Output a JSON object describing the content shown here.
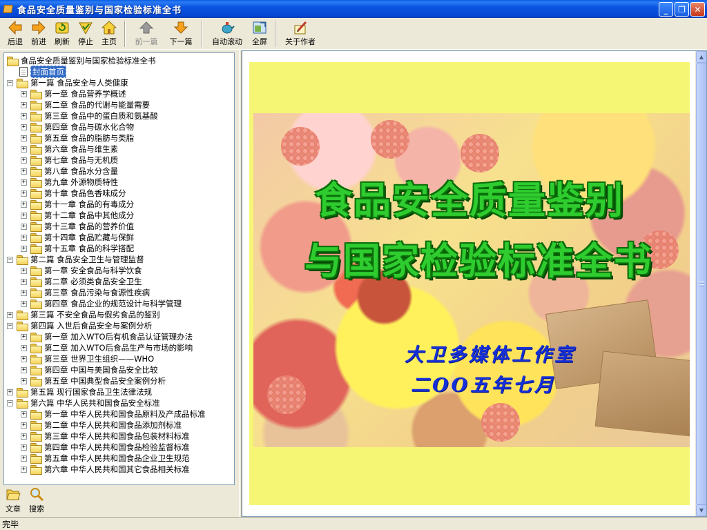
{
  "window": {
    "title": "食品安全质量鉴别与国家检验标准全书",
    "controls": {
      "minimize": "_",
      "maximize": "❐",
      "close": "✕"
    }
  },
  "toolbar": {
    "back": "后退",
    "forward": "前进",
    "refresh": "刷新",
    "stop": "停止",
    "home": "主页",
    "prev_article": "前一篇",
    "next_article": "下一篇",
    "auto_scroll": "自动滚动",
    "fullscreen": "全屏",
    "about": "关于作者"
  },
  "tree": {
    "root": "食品安全质量鉴别与国家检验标准全书",
    "cover": "封面首页",
    "nodes": [
      {
        "label": "第一篇  食品安全与人类健康",
        "level": 1,
        "expanded": true
      },
      {
        "label": "第一章  食品营养学概述",
        "level": 2
      },
      {
        "label": "第二章  食品的代谢与能量需要",
        "level": 2
      },
      {
        "label": "第三章  食品中的蛋白质和氨基酸",
        "level": 2
      },
      {
        "label": "第四章  食品与碳水化合物",
        "level": 2
      },
      {
        "label": "第五章  食品的脂肪与类脂",
        "level": 2
      },
      {
        "label": "第六章  食品与维生素",
        "level": 2
      },
      {
        "label": "第七章  食品与无机质",
        "level": 2
      },
      {
        "label": "第八章  食品水分含量",
        "level": 2
      },
      {
        "label": "第九章  外源物质特性",
        "level": 2
      },
      {
        "label": "第十章  食品色香味成分",
        "level": 2
      },
      {
        "label": "第十一章  食品的有毒成分",
        "level": 2
      },
      {
        "label": "第十二章  食品中其他成分",
        "level": 2
      },
      {
        "label": "第十三章  食品的营养价值",
        "level": 2
      },
      {
        "label": "第十四章  食品贮藏与保鲜",
        "level": 2
      },
      {
        "label": "第十五章  食品的科学搭配",
        "level": 2
      },
      {
        "label": "第二篇  食品安全卫生与管理监督",
        "level": 1,
        "expanded": true
      },
      {
        "label": "第一章  安全食品与科学饮食",
        "level": 2
      },
      {
        "label": "第二章  必须类食品安全卫生",
        "level": 2
      },
      {
        "label": "第三章  食品污染与食源性疾病",
        "level": 2
      },
      {
        "label": "第四章  食品企业的规范设计与科学管理",
        "level": 2
      },
      {
        "label": "第三篇  不安全食品与假劣食品的鉴别",
        "level": 1,
        "expanded": false
      },
      {
        "label": "第四篇  入世后食品安全与案例分析",
        "level": 1,
        "expanded": true
      },
      {
        "label": "第一章  加入WTO后有机食品认证管理办法",
        "level": 2
      },
      {
        "label": "第二章  加入WTO后食品生产与市场的影响",
        "level": 2
      },
      {
        "label": "第三章  世界卫生组织——WHO",
        "level": 2
      },
      {
        "label": "第四章  中国与美国食品安全比较",
        "level": 2
      },
      {
        "label": "第五章  中国典型食品安全案例分析",
        "level": 2
      },
      {
        "label": "第五篇  现行国家食品卫生法律法规",
        "level": 1,
        "expanded": false
      },
      {
        "label": "第六篇  中华人民共和国食品安全标准",
        "level": 1,
        "expanded": true
      },
      {
        "label": "第一章  中华人民共和国食品原料及产成品标准",
        "level": 2
      },
      {
        "label": "第二章  中华人民共和国食品添加剂标准",
        "level": 2
      },
      {
        "label": "第三章  中华人民共和国食品包装材料标准",
        "level": 2
      },
      {
        "label": "第四章  中华人民共和国食品检验监督标准",
        "level": 2
      },
      {
        "label": "第五章  中华人民共和国食品企业卫生规范",
        "level": 2
      },
      {
        "label": "第六章  中华人民共和国其它食品相关标准",
        "level": 2
      }
    ]
  },
  "sidebar_tabs": {
    "articles": "文章",
    "search": "搜索"
  },
  "cover": {
    "title_line1": "食品安全质量鉴别",
    "title_line2": "与国家检验标准全书",
    "studio": "大卫多媒体工作室",
    "date": "二OO五年七月",
    "colors": {
      "background": "#f6f675",
      "title": "#2fcc2f",
      "subtitle": "#1630d8"
    }
  },
  "status": {
    "text": "完毕"
  }
}
